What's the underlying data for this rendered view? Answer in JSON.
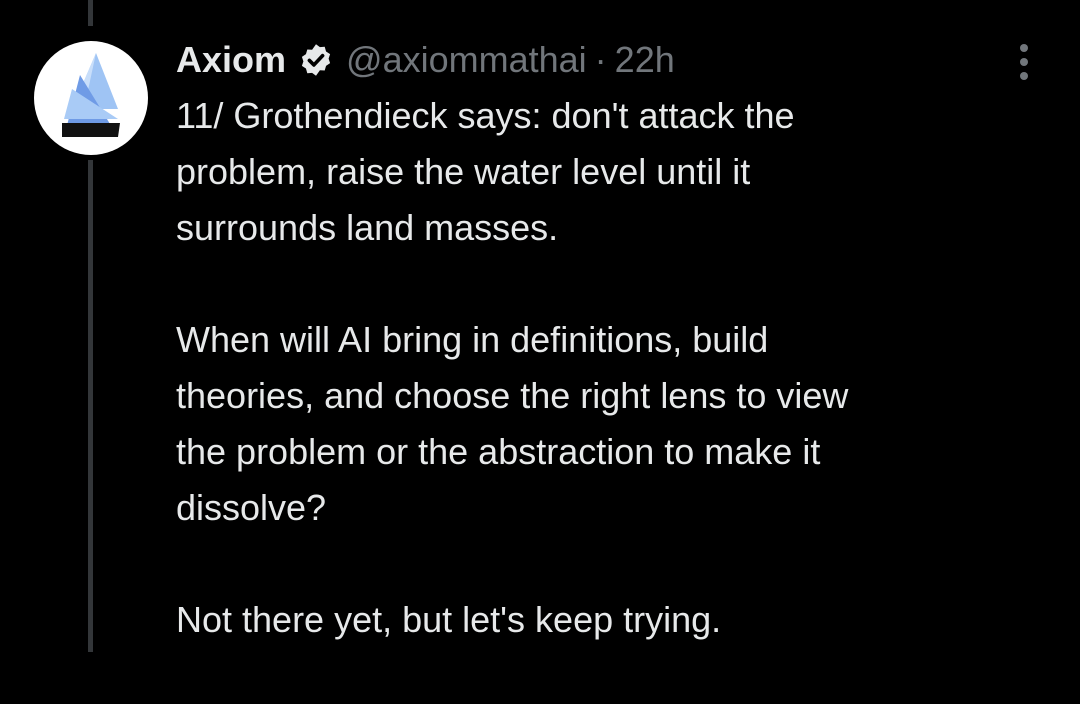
{
  "tweet": {
    "author": {
      "display_name": "Axiom",
      "handle": "@axiommathai",
      "verified": true,
      "avatar_icon": "axiom-logo-icon"
    },
    "separator": "·",
    "time": "22h",
    "paragraphs": [
      "11/ Grothendieck says: don't attack the\nproblem, raise the water level until it\nsurrounds land masses.",
      "When will AI bring in definitions, build\ntheories, and choose the right lens to view\nthe problem or the abstraction to make it\ndissolve?",
      "Not there yet, but let's keep trying."
    ]
  },
  "colors": {
    "background": "#000000",
    "text": "#e7e9ea",
    "muted": "#71767b",
    "thread_line": "#333639",
    "verified_badge": "#e7e9ea"
  }
}
